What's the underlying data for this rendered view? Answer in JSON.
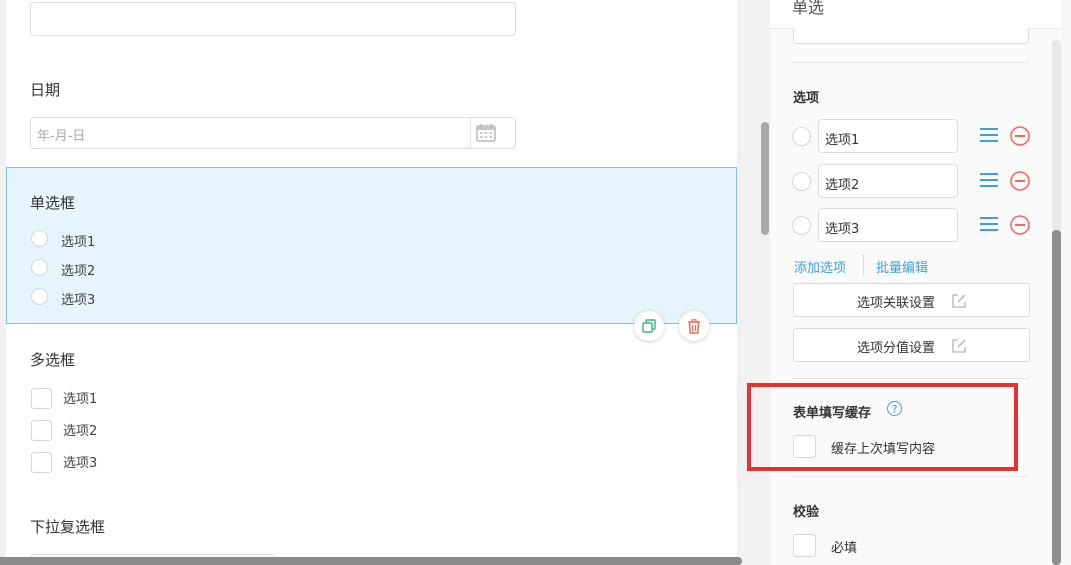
{
  "form": {
    "date_field": {
      "title": "日期",
      "placeholder": "年-月-日"
    },
    "radio_field": {
      "title": "单选框",
      "options": [
        "选项1",
        "选项2",
        "选项3"
      ]
    },
    "checkbox_field": {
      "title": "多选框",
      "options": [
        "选项1",
        "选项2",
        "选项3"
      ]
    },
    "dropdown_multi_field": {
      "title": "下拉复选框"
    }
  },
  "panel": {
    "header_title": "单选",
    "options_section": {
      "title": "选项",
      "options": [
        "选项1",
        "选项2",
        "选项3"
      ],
      "add_option_link": "添加选项",
      "batch_edit_link": "批量编辑",
      "association_button": "选项关联设置",
      "score_button": "选项分值设置"
    },
    "cache_section": {
      "title": "表单填写缓存",
      "help_glyph": "?",
      "checkbox_label": "缓存上次填写内容"
    },
    "validation_section": {
      "title": "校验",
      "required_label": "必填"
    }
  },
  "colors": {
    "accent": "#3ca0e0",
    "selected_bg": "#e6f4fd",
    "danger": "#f26a5f",
    "highlight": "#e8312d",
    "copy_icon": "#36b37e"
  },
  "icons": [
    "calendar-icon",
    "copy-icon",
    "trash-icon",
    "drag-menu-icon",
    "remove-circle-icon",
    "edit-icon",
    "help-icon"
  ]
}
